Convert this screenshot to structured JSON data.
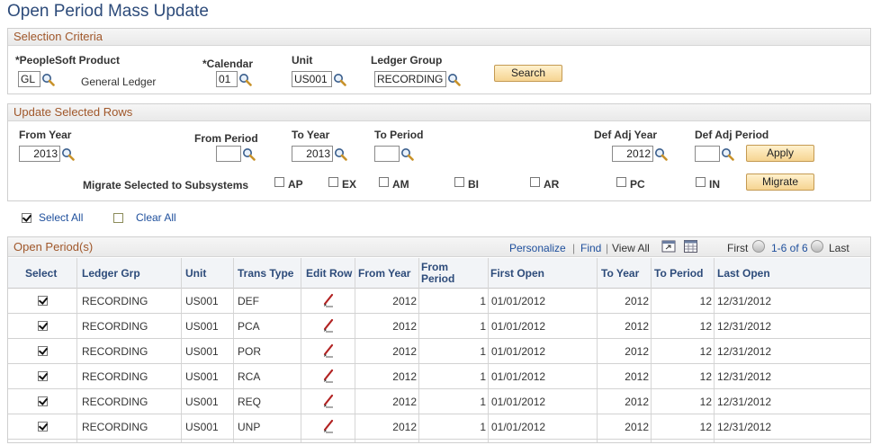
{
  "page": {
    "title": "Open Period Mass Update"
  },
  "selection": {
    "header": "Selection Criteria",
    "product_label": "*PeopleSoft Product",
    "product_value": "GL",
    "product_desc": "General Ledger",
    "calendar_label": "*Calendar",
    "calendar_value": "01",
    "unit_label": "Unit",
    "unit_value": "US001",
    "ledger_group_label": "Ledger Group",
    "ledger_group_value": "RECORDING",
    "search_label": "Search"
  },
  "update": {
    "header": "Update Selected Rows",
    "from_year_label": "From Year",
    "from_year_value": "2013",
    "from_period_label": "From Period",
    "from_period_value": "",
    "to_year_label": "To Year",
    "to_year_value": "2013",
    "to_period_label": "To Period",
    "to_period_value": "",
    "def_adj_year_label": "Def Adj Year",
    "def_adj_year_value": "2012",
    "def_adj_period_label": "Def Adj Period",
    "def_adj_period_value": "",
    "apply_label": "Apply",
    "migrate_text": "Migrate Selected to Subsystems",
    "subsystems": [
      "AP",
      "EX",
      "AM",
      "BI",
      "AR",
      "PC",
      "IN"
    ],
    "migrate_label": "Migrate"
  },
  "select_all": {
    "label": "Select All",
    "checked": true
  },
  "clear_all": {
    "label": "Clear All",
    "checked": false
  },
  "grid": {
    "title": "Open Period(s)",
    "personalize": "Personalize",
    "find": "Find",
    "separator": "|",
    "view_all": "View All",
    "first": "First",
    "range": "1-6 of 6",
    "last": "Last",
    "columns": {
      "select": "Select",
      "ledger_grp": "Ledger Grp",
      "unit": "Unit",
      "trans_type": "Trans Type",
      "edit_row": "Edit Row",
      "from_year": "From Year",
      "from_period_1": "From",
      "from_period_2": "Period",
      "first_open": "First Open",
      "to_year": "To Year",
      "to_period": "To Period",
      "last_open": "Last Open"
    },
    "rows": [
      {
        "selected": true,
        "ledger_grp": "RECORDING",
        "unit": "US001",
        "trans_type": "DEF",
        "from_year": "2012",
        "from_period": "1",
        "first_open": "01/01/2012",
        "to_year": "2012",
        "to_period": "12",
        "last_open": "12/31/2012"
      },
      {
        "selected": true,
        "ledger_grp": "RECORDING",
        "unit": "US001",
        "trans_type": "PCA",
        "from_year": "2012",
        "from_period": "1",
        "first_open": "01/01/2012",
        "to_year": "2012",
        "to_period": "12",
        "last_open": "12/31/2012"
      },
      {
        "selected": true,
        "ledger_grp": "RECORDING",
        "unit": "US001",
        "trans_type": "POR",
        "from_year": "2012",
        "from_period": "1",
        "first_open": "01/01/2012",
        "to_year": "2012",
        "to_period": "12",
        "last_open": "12/31/2012"
      },
      {
        "selected": true,
        "ledger_grp": "RECORDING",
        "unit": "US001",
        "trans_type": "RCA",
        "from_year": "2012",
        "from_period": "1",
        "first_open": "01/01/2012",
        "to_year": "2012",
        "to_period": "12",
        "last_open": "12/31/2012"
      },
      {
        "selected": true,
        "ledger_grp": "RECORDING",
        "unit": "US001",
        "trans_type": "REQ",
        "from_year": "2012",
        "from_period": "1",
        "first_open": "01/01/2012",
        "to_year": "2012",
        "to_period": "12",
        "last_open": "12/31/2012"
      },
      {
        "selected": true,
        "ledger_grp": "RECORDING",
        "unit": "US001",
        "trans_type": "UNP",
        "from_year": "2012",
        "from_period": "1",
        "first_open": "01/01/2012",
        "to_year": "2012",
        "to_period": "12",
        "last_open": "12/31/2012"
      }
    ]
  },
  "colors": {
    "title": "#2d4b7a",
    "section_header": "#a0572a",
    "link": "#1e4f9c",
    "button_fill": "#f6d491"
  }
}
